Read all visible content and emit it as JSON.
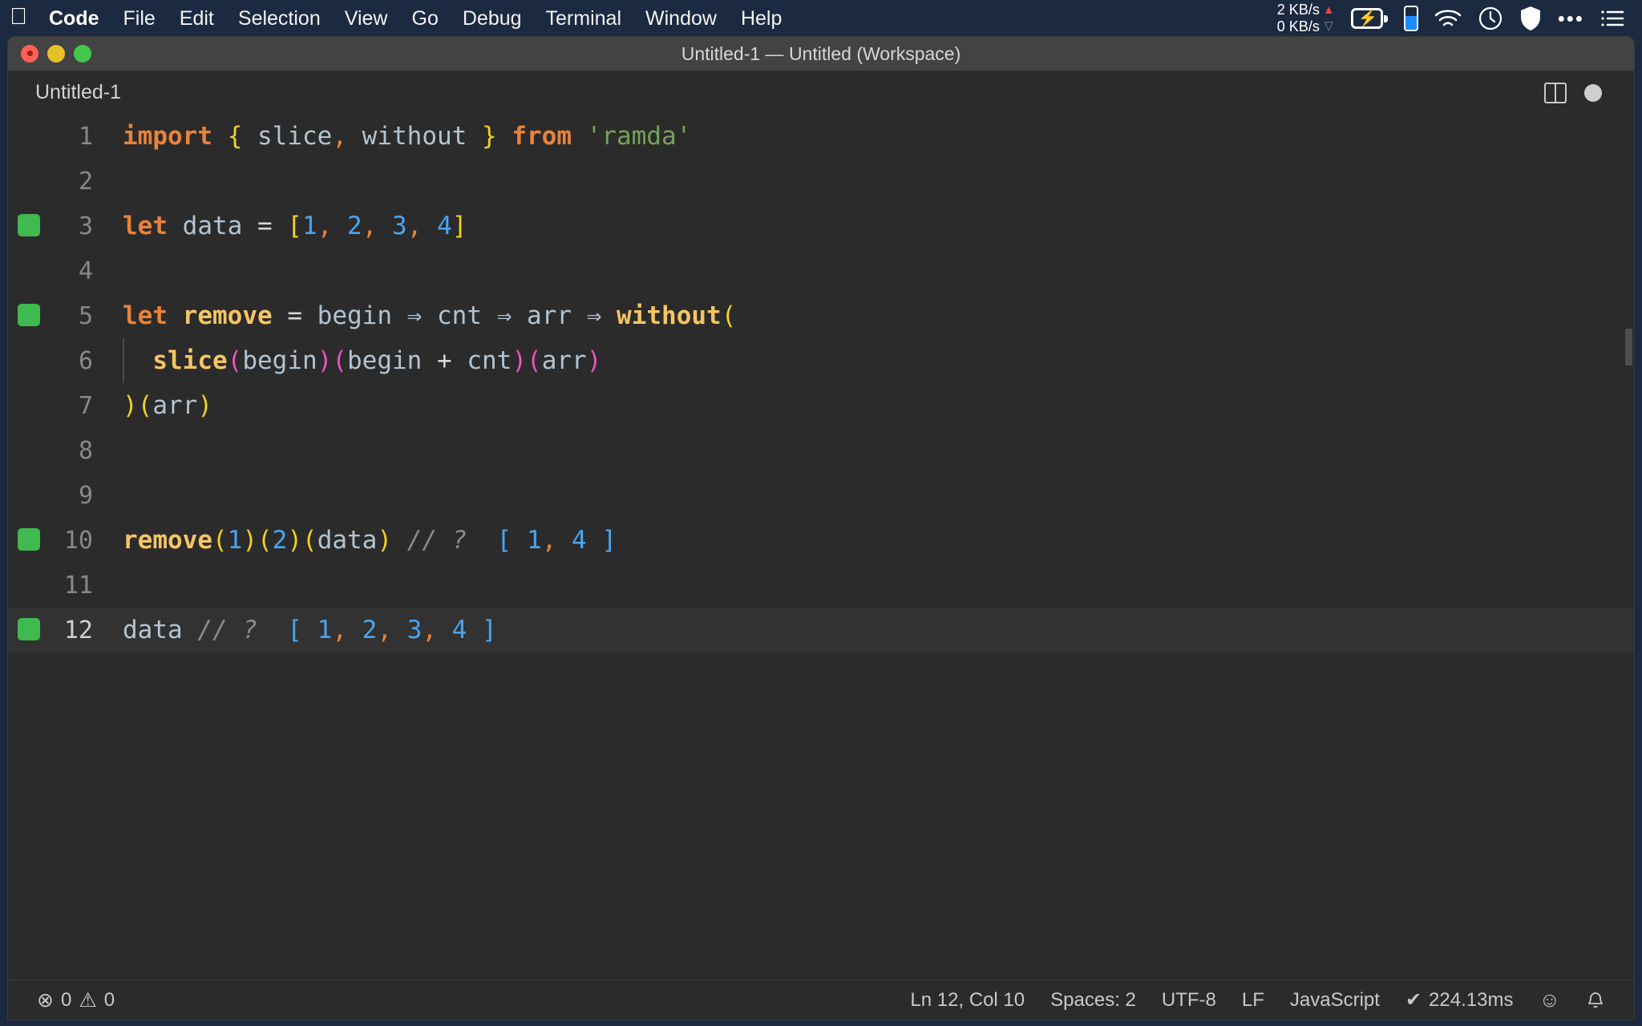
{
  "menubar": {
    "apple_icon": "apple-logo-icon",
    "items": [
      {
        "label": "Code",
        "bold": true
      },
      {
        "label": "File",
        "bold": false
      },
      {
        "label": "Edit",
        "bold": false
      },
      {
        "label": "Selection",
        "bold": false
      },
      {
        "label": "View",
        "bold": false
      },
      {
        "label": "Go",
        "bold": false
      },
      {
        "label": "Debug",
        "bold": false
      },
      {
        "label": "Terminal",
        "bold": false
      },
      {
        "label": "Window",
        "bold": false
      },
      {
        "label": "Help",
        "bold": false
      }
    ],
    "tray": {
      "net_up": "2 KB/s",
      "net_down": "0 KB/s",
      "up_arrow": "▲",
      "down_arrow": "▽",
      "battery_icon": "battery-charging-icon",
      "phone_battery_icon": "phone-battery-icon",
      "wifi_icon": "wifi-icon",
      "clock_icon": "clock-icon",
      "shield_icon": "shield-icon",
      "dots_icon": "•••",
      "list_icon": "list-menu-icon"
    },
    "accent_up_color": "#e8453c",
    "accent_phone_color": "#1a8cff",
    "bar_color": "#1b2a41"
  },
  "window": {
    "title": "Untitled-1 — Untitled (Workspace)",
    "traffic_lights": [
      "close",
      "minimize",
      "maximize"
    ],
    "colors": {
      "close": "#ff5f57",
      "minimize": "#e6c029",
      "maximize": "#41c84a"
    }
  },
  "tabbar": {
    "active_tab_label": "Untitled-1",
    "split_editor_icon": "split-editor-icon",
    "unsaved_indicator_icon": "unsaved-dot-icon"
  },
  "editor": {
    "language": "JavaScript",
    "active_line": 12,
    "marker_color": "#3fb950",
    "lines": [
      {
        "num": "1",
        "marker": false,
        "indent_guide": false,
        "tokens": [
          {
            "t": "import",
            "c": "t-kw"
          },
          {
            "t": " ",
            "c": "t-plain"
          },
          {
            "t": "{",
            "c": "t-br1"
          },
          {
            "t": " ",
            "c": "t-plain"
          },
          {
            "t": "slice",
            "c": "t-var"
          },
          {
            "t": ",",
            "c": "t-comma"
          },
          {
            "t": " ",
            "c": "t-plain"
          },
          {
            "t": "without",
            "c": "t-var"
          },
          {
            "t": " ",
            "c": "t-plain"
          },
          {
            "t": "}",
            "c": "t-br1"
          },
          {
            "t": " ",
            "c": "t-plain"
          },
          {
            "t": "from",
            "c": "t-kw"
          },
          {
            "t": " ",
            "c": "t-plain"
          },
          {
            "t": "'ramda'",
            "c": "t-str"
          }
        ]
      },
      {
        "num": "2",
        "marker": false,
        "indent_guide": false,
        "tokens": []
      },
      {
        "num": "3",
        "marker": true,
        "indent_guide": false,
        "tokens": [
          {
            "t": "let",
            "c": "t-kw"
          },
          {
            "t": " ",
            "c": "t-plain"
          },
          {
            "t": "data",
            "c": "t-var"
          },
          {
            "t": " ",
            "c": "t-plain"
          },
          {
            "t": "=",
            "c": "t-op"
          },
          {
            "t": " ",
            "c": "t-plain"
          },
          {
            "t": "[",
            "c": "t-br1"
          },
          {
            "t": "1",
            "c": "t-num"
          },
          {
            "t": ",",
            "c": "t-comma"
          },
          {
            "t": " ",
            "c": "t-plain"
          },
          {
            "t": "2",
            "c": "t-num"
          },
          {
            "t": ",",
            "c": "t-comma"
          },
          {
            "t": " ",
            "c": "t-plain"
          },
          {
            "t": "3",
            "c": "t-num"
          },
          {
            "t": ",",
            "c": "t-comma"
          },
          {
            "t": " ",
            "c": "t-plain"
          },
          {
            "t": "4",
            "c": "t-num"
          },
          {
            "t": "]",
            "c": "t-br1"
          }
        ]
      },
      {
        "num": "4",
        "marker": false,
        "indent_guide": false,
        "tokens": []
      },
      {
        "num": "5",
        "marker": true,
        "indent_guide": false,
        "tokens": [
          {
            "t": "let",
            "c": "t-kw"
          },
          {
            "t": " ",
            "c": "t-plain"
          },
          {
            "t": "remove",
            "c": "t-fn"
          },
          {
            "t": " ",
            "c": "t-plain"
          },
          {
            "t": "=",
            "c": "t-op"
          },
          {
            "t": " ",
            "c": "t-plain"
          },
          {
            "t": "begin",
            "c": "t-var"
          },
          {
            "t": " ",
            "c": "t-plain"
          },
          {
            "t": "⇒",
            "c": "t-arrow"
          },
          {
            "t": " ",
            "c": "t-plain"
          },
          {
            "t": "cnt",
            "c": "t-var"
          },
          {
            "t": " ",
            "c": "t-plain"
          },
          {
            "t": "⇒",
            "c": "t-arrow"
          },
          {
            "t": " ",
            "c": "t-plain"
          },
          {
            "t": "arr",
            "c": "t-var"
          },
          {
            "t": " ",
            "c": "t-plain"
          },
          {
            "t": "⇒",
            "c": "t-arrow"
          },
          {
            "t": " ",
            "c": "t-plain"
          },
          {
            "t": "without",
            "c": "t-fn"
          },
          {
            "t": "(",
            "c": "t-br1"
          }
        ]
      },
      {
        "num": "6",
        "marker": false,
        "indent_guide": true,
        "tokens": [
          {
            "t": "  ",
            "c": "t-plain"
          },
          {
            "t": "slice",
            "c": "t-fn"
          },
          {
            "t": "(",
            "c": "t-br2"
          },
          {
            "t": "begin",
            "c": "t-var"
          },
          {
            "t": ")",
            "c": "t-br2"
          },
          {
            "t": "(",
            "c": "t-br2"
          },
          {
            "t": "begin",
            "c": "t-var"
          },
          {
            "t": " ",
            "c": "t-plain"
          },
          {
            "t": "+",
            "c": "t-op"
          },
          {
            "t": " ",
            "c": "t-plain"
          },
          {
            "t": "cnt",
            "c": "t-var"
          },
          {
            "t": ")",
            "c": "t-br2"
          },
          {
            "t": "(",
            "c": "t-br2"
          },
          {
            "t": "arr",
            "c": "t-var"
          },
          {
            "t": ")",
            "c": "t-br2"
          }
        ]
      },
      {
        "num": "7",
        "marker": false,
        "indent_guide": false,
        "tokens": [
          {
            "t": ")",
            "c": "t-br1"
          },
          {
            "t": "(",
            "c": "t-br1"
          },
          {
            "t": "arr",
            "c": "t-var"
          },
          {
            "t": ")",
            "c": "t-br1"
          }
        ]
      },
      {
        "num": "8",
        "marker": false,
        "indent_guide": false,
        "tokens": []
      },
      {
        "num": "9",
        "marker": false,
        "indent_guide": false,
        "tokens": []
      },
      {
        "num": "10",
        "marker": true,
        "indent_guide": false,
        "tokens": [
          {
            "t": "remove",
            "c": "t-fn"
          },
          {
            "t": "(",
            "c": "t-br1"
          },
          {
            "t": "1",
            "c": "t-num"
          },
          {
            "t": ")",
            "c": "t-br1"
          },
          {
            "t": "(",
            "c": "t-br1"
          },
          {
            "t": "2",
            "c": "t-num"
          },
          {
            "t": ")",
            "c": "t-br1"
          },
          {
            "t": "(",
            "c": "t-br1"
          },
          {
            "t": "data",
            "c": "t-var"
          },
          {
            "t": ")",
            "c": "t-br1"
          },
          {
            "t": " ",
            "c": "t-plain"
          },
          {
            "t": "// ?",
            "c": "t-comment"
          },
          {
            "t": "  ",
            "c": "t-plain"
          },
          {
            "t": "[",
            "c": "t-num"
          },
          {
            "t": " ",
            "c": "t-plain"
          },
          {
            "t": "1",
            "c": "t-num"
          },
          {
            "t": ",",
            "c": "t-comma"
          },
          {
            "t": " ",
            "c": "t-plain"
          },
          {
            "t": "4",
            "c": "t-num"
          },
          {
            "t": " ",
            "c": "t-plain"
          },
          {
            "t": "]",
            "c": "t-num"
          }
        ]
      },
      {
        "num": "11",
        "marker": false,
        "indent_guide": false,
        "tokens": []
      },
      {
        "num": "12",
        "marker": true,
        "indent_guide": false,
        "active": true,
        "tokens": [
          {
            "t": "data",
            "c": "t-var"
          },
          {
            "t": " ",
            "c": "t-plain"
          },
          {
            "t": "// ?",
            "c": "t-comment"
          },
          {
            "t": "  ",
            "c": "t-plain"
          },
          {
            "t": "[",
            "c": "t-num"
          },
          {
            "t": " ",
            "c": "t-plain"
          },
          {
            "t": "1",
            "c": "t-num"
          },
          {
            "t": ",",
            "c": "t-comma"
          },
          {
            "t": " ",
            "c": "t-plain"
          },
          {
            "t": "2",
            "c": "t-num"
          },
          {
            "t": ",",
            "c": "t-comma"
          },
          {
            "t": " ",
            "c": "t-plain"
          },
          {
            "t": "3",
            "c": "t-num"
          },
          {
            "t": ",",
            "c": "t-comma"
          },
          {
            "t": " ",
            "c": "t-plain"
          },
          {
            "t": "4",
            "c": "t-num"
          },
          {
            "t": " ",
            "c": "t-plain"
          },
          {
            "t": "]",
            "c": "t-num"
          }
        ]
      }
    ],
    "token_colors": {
      "keyword": "#e8833a",
      "function": "#f5c563",
      "variable": "#b3c3d1",
      "bracket_level1": "#f2d024",
      "bracket_level2": "#e855c0",
      "number": "#4aa5f0",
      "string": "#74a35a",
      "comma": "#e8833a",
      "comment": "#8b8b8b",
      "background": "#2b2b2b"
    }
  },
  "statusbar": {
    "error_icon": "⊗",
    "error_count": "0",
    "warning_icon": "⚠",
    "warning_count": "0",
    "cursor_position": "Ln 12, Col 10",
    "indentation": "Spaces: 2",
    "encoding": "UTF-8",
    "eol": "LF",
    "language_mode": "JavaScript",
    "run_check_icon": "✔",
    "run_time": "224.13ms",
    "feedback_icon": "☺",
    "notification_icon": "🔔"
  }
}
